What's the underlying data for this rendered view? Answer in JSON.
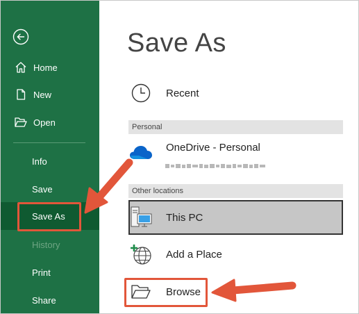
{
  "sidebar": {
    "items": [
      {
        "label": "Home",
        "icon": "home-icon"
      },
      {
        "label": "New",
        "icon": "new-file-icon"
      },
      {
        "label": "Open",
        "icon": "folder-open-icon"
      },
      {
        "label": "Info"
      },
      {
        "label": "Save"
      },
      {
        "label": "Save As",
        "selected": true
      },
      {
        "label": "History",
        "disabled": true
      },
      {
        "label": "Print"
      },
      {
        "label": "Share"
      }
    ]
  },
  "main": {
    "title": "Save As",
    "recent_label": "Recent",
    "section_personal": "Personal",
    "onedrive_label": "OneDrive - Personal",
    "section_other": "Other locations",
    "thispc_label": "This PC",
    "addplace_label": "Add a Place",
    "browse_label": "Browse"
  },
  "colors": {
    "sidebar_bg": "#1e7145",
    "selected_bg": "#0f5a31",
    "annotation": "#e2563a"
  }
}
